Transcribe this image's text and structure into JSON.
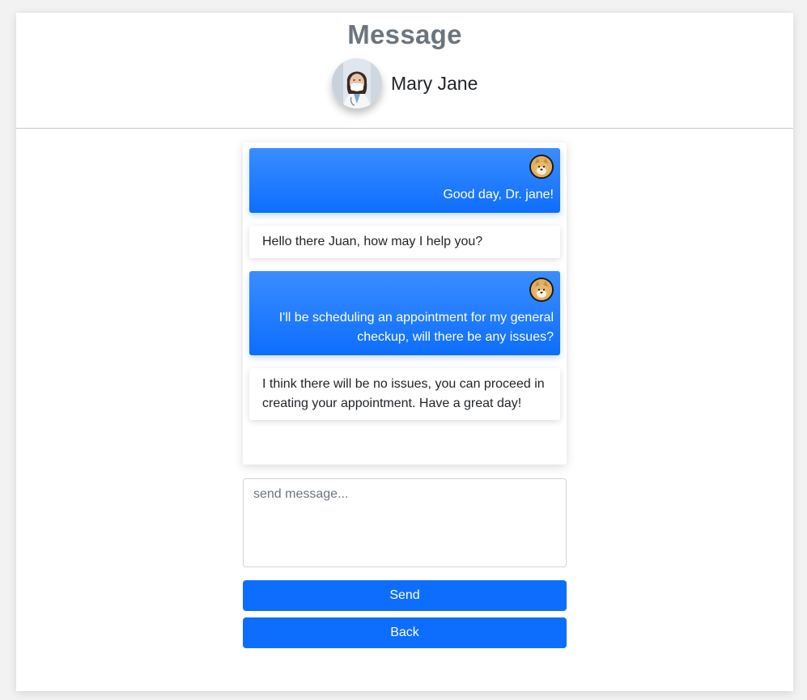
{
  "header": {
    "title": "Message",
    "contact_name": "Mary Jane",
    "contact_avatar_icon": "doctor-avatar-photo"
  },
  "chat": {
    "messages": [
      {
        "direction": "sent",
        "text": "Good day, Dr. jane!",
        "avatar_icon": "shiba-avatar"
      },
      {
        "direction": "received",
        "text": "Hello there Juan, how may I help you?"
      },
      {
        "direction": "sent",
        "text": "I'll be scheduling an appointment for my general checkup, will there be any issues?",
        "avatar_icon": "shiba-avatar"
      },
      {
        "direction": "received",
        "text": "I think there will be no issues, you can proceed in creating your appointment. Have a great day!"
      }
    ]
  },
  "composer": {
    "placeholder": "send message...",
    "value": "",
    "send_label": "Send",
    "back_label": "Back"
  },
  "colors": {
    "primary": "#0d6efd",
    "title": "#6c757d",
    "text": "#212529"
  }
}
